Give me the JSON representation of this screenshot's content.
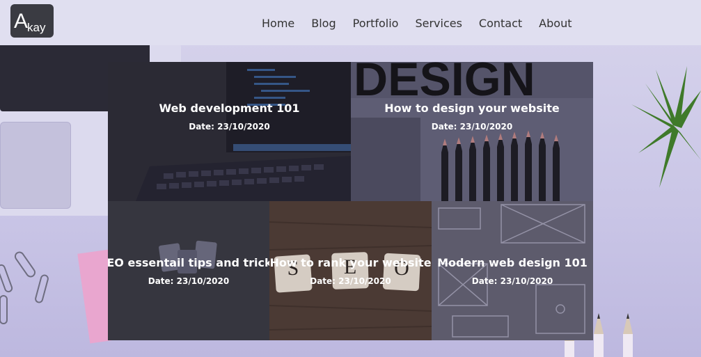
{
  "header": {
    "logo": {
      "big": "A",
      "small": "kay"
    },
    "nav": [
      "Home",
      "Blog",
      "Portfolio",
      "Services",
      "Contact",
      "About"
    ]
  },
  "posts": [
    {
      "title": "Web development 101",
      "date": "Date: 23/10/2020"
    },
    {
      "title": "How to design your website",
      "date": "Date: 23/10/2020"
    },
    {
      "title": "SEO essentail tips and tricks",
      "date": "Date: 23/10/2020"
    },
    {
      "title": "How to rank your website",
      "date": "Date: 23/10/2020"
    },
    {
      "title": "Modern web design 101",
      "date": "Date: 23/10/2020"
    }
  ],
  "images": {
    "design_word": "DESIGN",
    "seo_tiles": [
      "S",
      "E",
      "O"
    ]
  },
  "colors": {
    "header_bg": "#e0dff0",
    "logo_bg": "#3a3b42",
    "nav_text": "#333333",
    "card_text": "#ffffff"
  }
}
